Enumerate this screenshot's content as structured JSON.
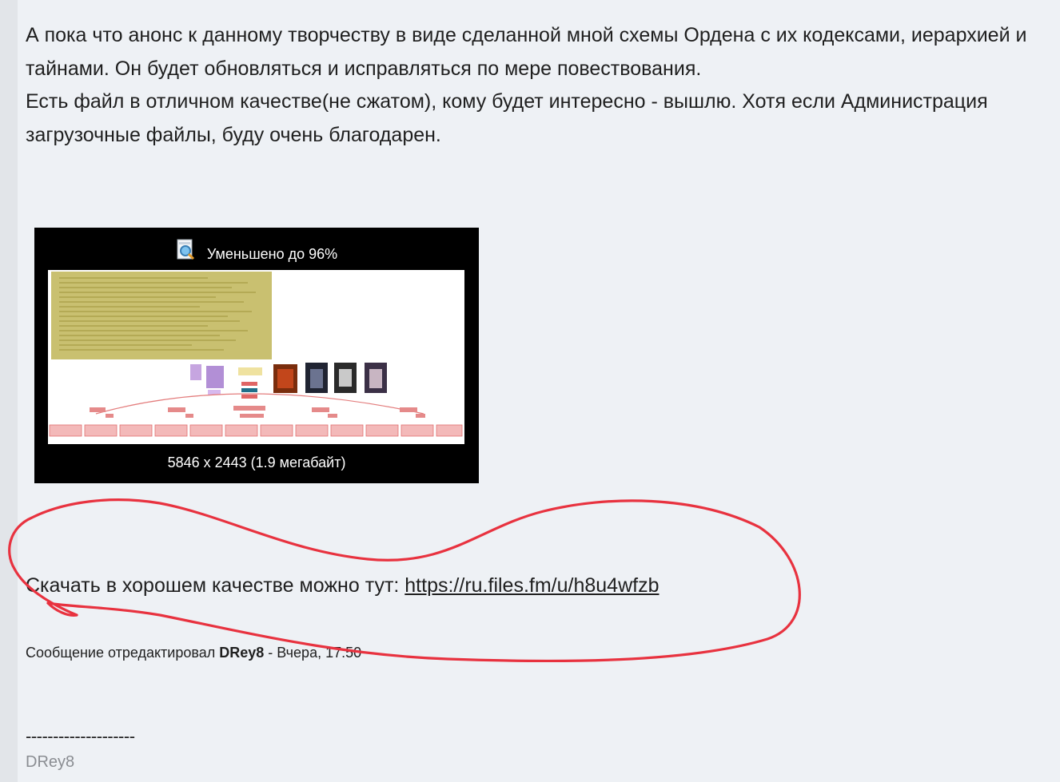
{
  "post": {
    "paragraph_lines": [
      "А пока что анонс к данному творчеству в виде сделанной мной схемы Ордена с их кодексами, иерархией и",
      "тайнами. Он будет обновляться и исправляться по мере повествования.",
      "Есть файл в отличном качестве(не сжатом), кому будет интересно - вышлю. Хотя если Администрация",
      "загрузочные файлы, буду очень благодарен."
    ]
  },
  "thumbnail": {
    "caption": "Уменьшено до 96%",
    "size_info": "5846 x 2443 (1.9 мегабайт)",
    "icon": "magnifier-icon"
  },
  "download": {
    "label": "Скачать в хорошем качестве можно тут: ",
    "link_text": "https://ru.files.fm/u/h8u4wfzb"
  },
  "edit_note": {
    "prefix": "Сообщение отредактировал ",
    "author": "DRey8",
    "suffix": " - Вчера, 17:50"
  },
  "signature": {
    "separator": "--------------------",
    "name": "DRey8"
  },
  "colors": {
    "background": "#eef1f5",
    "annotation": "#e8323f",
    "signature": "#8a8d92"
  }
}
